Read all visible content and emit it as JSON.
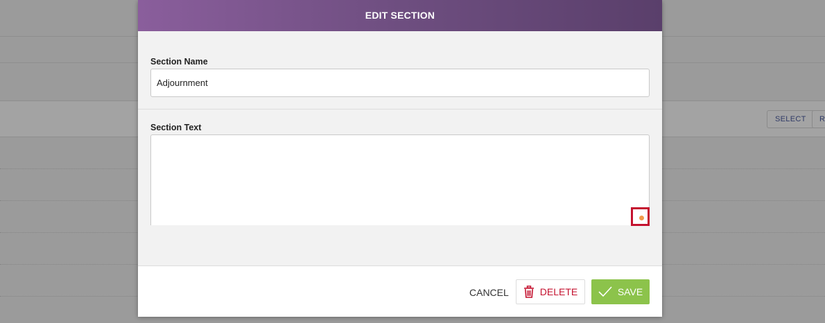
{
  "background": {
    "buttons": [
      {
        "label": "SELECT"
      },
      {
        "label": "RE"
      }
    ]
  },
  "modal": {
    "title": "EDIT SECTION",
    "section_name": {
      "label": "Section Name",
      "value": "Adjournment"
    },
    "section_text": {
      "label": "Section Text",
      "value": ""
    },
    "footer": {
      "cancel_label": "CANCEL",
      "delete_label": "DELETE",
      "save_label": "SAVE"
    }
  },
  "colors": {
    "header_gradient_start": "#8a5e9c",
    "header_gradient_end": "#5a3f6b",
    "delete": "#c4122f",
    "save": "#8cc34b",
    "highlight_box": "#c4122f",
    "resize_dot": "#f29a4a"
  },
  "icons": {
    "delete": "trash-icon",
    "save": "checkmark-icon",
    "resize": "resize-handle-icon"
  }
}
